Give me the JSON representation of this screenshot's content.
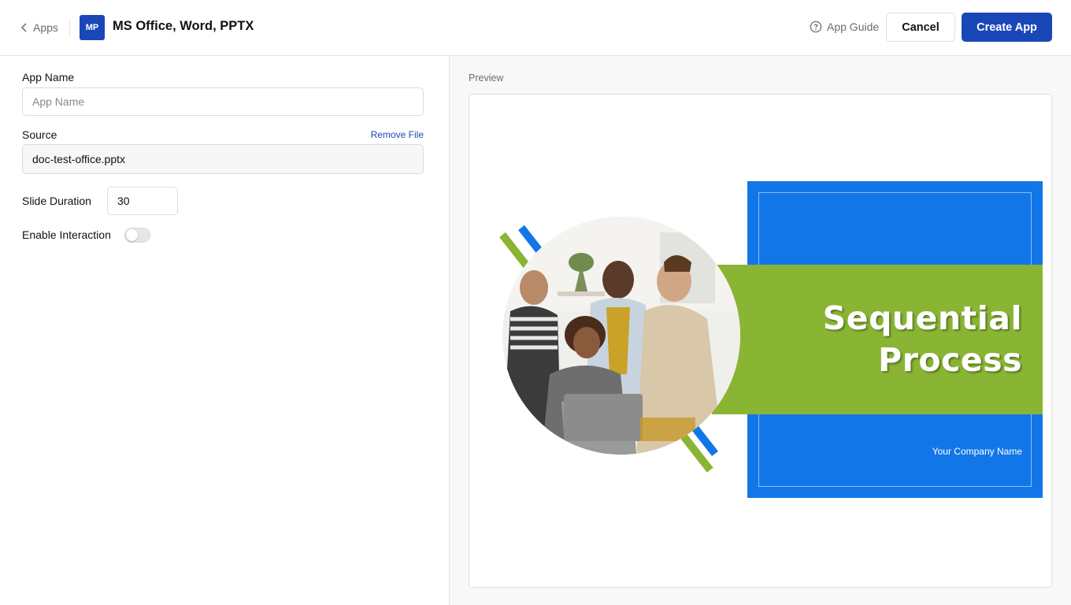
{
  "header": {
    "back_label": "Apps",
    "app_badge": "MP",
    "app_title": "MS Office, Word, PPTX",
    "guide_label": "App Guide",
    "cancel_label": "Cancel",
    "create_label": "Create App",
    "accent_color": "#1a47b8"
  },
  "form": {
    "app_name_label": "App Name",
    "app_name_placeholder": "App Name",
    "app_name_value": "",
    "source_label": "Source",
    "remove_file_label": "Remove File",
    "source_value": "doc-test-office.pptx",
    "slide_duration_label": "Slide Duration",
    "slide_duration_value": "30",
    "enable_interaction_label": "Enable Interaction",
    "enable_interaction_on": false
  },
  "preview": {
    "label": "Preview",
    "slide": {
      "title_line1": "Sequential",
      "title_line2": "Process",
      "company": "Your Company Name",
      "colors": {
        "blue": "#1177e8",
        "green": "#8ab534"
      }
    }
  }
}
